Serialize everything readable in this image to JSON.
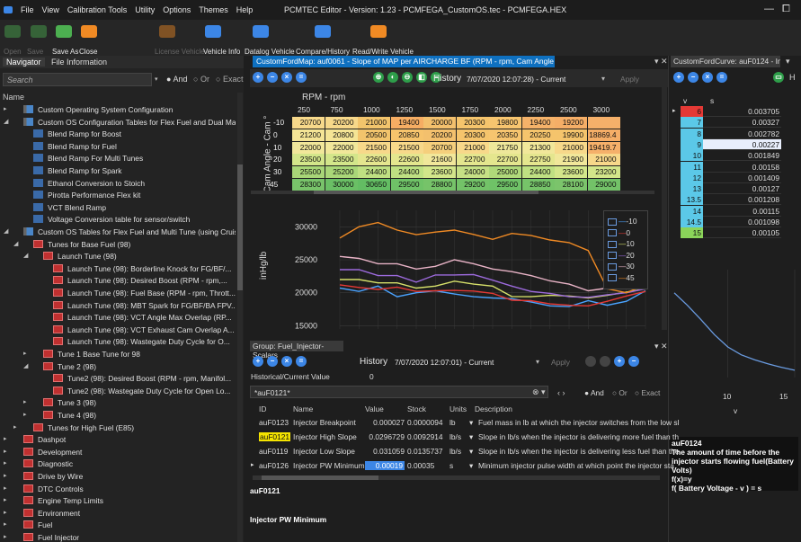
{
  "app": {
    "menu": [
      "File",
      "View",
      "Calibration Tools",
      "Utility",
      "Options",
      "Themes",
      "Help"
    ],
    "title": "PCMTEC Editor - Version: 1.23 - PCMFEGA_CustomOS.tec - PCMFEGA.HEX",
    "window_controls": [
      "—",
      "⧠"
    ]
  },
  "ribbon": {
    "labels": [
      "Open",
      "Save",
      "Save As",
      "Close",
      "License Vehicle",
      "Vehicle Info",
      "Datalog Vehicle",
      "Compare/History",
      "Read/Write Vehicle"
    ],
    "active_labels": [
      "Save As",
      "Close",
      "Vehicle Info",
      "Datalog Vehicle",
      "Compare/History",
      "Read/Write Vehicle"
    ],
    "colors": {
      "green": "#4caf50",
      "orange": "#f08a24",
      "blue": "#3c86e6"
    }
  },
  "navigator": {
    "tabs": [
      "Navigator",
      "File Information"
    ],
    "search_placeholder": "Search",
    "radio_and": "And",
    "radio_or": "Or",
    "radio_exact": "Exact",
    "column": "Name",
    "items": [
      {
        "indent": 0,
        "arrow": "▸",
        "icon": "cfg",
        "label": "Custom Operating System Configuration"
      },
      {
        "indent": 0,
        "arrow": "◢",
        "icon": "cfg",
        "label": "Custom OS Configuration Tables for Flex Fuel and Dual Ma..."
      },
      {
        "indent": 1,
        "arrow": "",
        "icon": "blue",
        "label": "Blend Ramp for Boost"
      },
      {
        "indent": 1,
        "arrow": "",
        "icon": "blue",
        "label": "Blend Ramp for Fuel"
      },
      {
        "indent": 1,
        "arrow": "",
        "icon": "blue",
        "label": "Blend Ramp For Multi Tunes"
      },
      {
        "indent": 1,
        "arrow": "",
        "icon": "blue",
        "label": "Blend Ramp for Spark"
      },
      {
        "indent": 1,
        "arrow": "",
        "icon": "blue",
        "label": "Ethanol Conversion to Stoich"
      },
      {
        "indent": 1,
        "arrow": "",
        "icon": "blue",
        "label": "Pirotta Performance Flex kit"
      },
      {
        "indent": 1,
        "arrow": "",
        "icon": "blue",
        "label": "VCT Blend Ramp"
      },
      {
        "indent": 1,
        "arrow": "",
        "icon": "blue",
        "label": "Voltage Conversion table for sensor/switch"
      },
      {
        "indent": 0,
        "arrow": "◢",
        "icon": "cfg",
        "label": "Custom OS Tables for Flex Fuel and Multi Tune (using Cruis..."
      },
      {
        "indent": 1,
        "arrow": "◢",
        "icon": "sheet",
        "label": "Tunes for Base Fuel (98)"
      },
      {
        "indent": 2,
        "arrow": "◢",
        "icon": "sheet",
        "label": "Launch Tune (98)"
      },
      {
        "indent": 3,
        "arrow": "",
        "icon": "sheet",
        "label": "Launch Tune (98): Borderline Knock for FG/BF/..."
      },
      {
        "indent": 3,
        "arrow": "",
        "icon": "sheet",
        "label": "Launch Tune (98): Desired Boost (RPM - rpm,..."
      },
      {
        "indent": 3,
        "arrow": "",
        "icon": "sheet",
        "label": "Launch Tune (98): Fuel Base (RPM - rpm, Thrott..."
      },
      {
        "indent": 3,
        "arrow": "",
        "icon": "sheet",
        "label": "Launch Tune (98): MBT Spark for FG/BF/BA FPV..."
      },
      {
        "indent": 3,
        "arrow": "",
        "icon": "sheet",
        "label": "Launch Tune (98): VCT Angle Max Overlap (RP..."
      },
      {
        "indent": 3,
        "arrow": "",
        "icon": "sheet",
        "label": "Launch Tune (98): VCT Exhaust Cam Overlap A..."
      },
      {
        "indent": 3,
        "arrow": "",
        "icon": "sheet",
        "label": "Launch Tune (98): Wastegate Duty Cycle for O..."
      },
      {
        "indent": 2,
        "arrow": "▸",
        "icon": "sheet",
        "label": "Tune 1 Base Tune for 98"
      },
      {
        "indent": 2,
        "arrow": "◢",
        "icon": "sheet",
        "label": "Tune 2 (98)"
      },
      {
        "indent": 3,
        "arrow": "",
        "icon": "sheet",
        "label": "Tune2 (98): Desired Boost (RPM - rpm, Manifol..."
      },
      {
        "indent": 3,
        "arrow": "",
        "icon": "sheet",
        "label": "Tune2 (98): Wastegate Duty Cycle for Open Lo..."
      },
      {
        "indent": 2,
        "arrow": "▸",
        "icon": "sheet",
        "label": "Tune 3 (98)"
      },
      {
        "indent": 2,
        "arrow": "▸",
        "icon": "sheet",
        "label": "Tune 4 (98)"
      },
      {
        "indent": 1,
        "arrow": "▸",
        "icon": "sheet",
        "label": "Tunes for High Fuel (E85)"
      },
      {
        "indent": 0,
        "arrow": "▸",
        "icon": "sheet",
        "label": "Dashpot"
      },
      {
        "indent": 0,
        "arrow": "▸",
        "icon": "sheet",
        "label": "Development"
      },
      {
        "indent": 0,
        "arrow": "▸",
        "icon": "sheet",
        "label": "Diagnostic"
      },
      {
        "indent": 0,
        "arrow": "▸",
        "icon": "sheet",
        "label": "Drive by Wire"
      },
      {
        "indent": 0,
        "arrow": "▸",
        "icon": "sheet",
        "label": "DTC Controls"
      },
      {
        "indent": 0,
        "arrow": "▸",
        "icon": "sheet",
        "label": "Engine Temp Limits"
      },
      {
        "indent": 0,
        "arrow": "▸",
        "icon": "sheet",
        "label": "Environment"
      },
      {
        "indent": 0,
        "arrow": "▸",
        "icon": "sheet",
        "label": "Fuel"
      },
      {
        "indent": 0,
        "arrow": "▸",
        "icon": "sheet",
        "label": "Fuel Injector"
      }
    ]
  },
  "map": {
    "tab": "CustomFordMap: auf0061 - Slope of MAP per AIRCHARGE BF (RPM - rpm, Cam Angle - Cam °)",
    "history_label": "History",
    "history_value": "7/07/2020 12:07:28) - Current",
    "apply": "Apply",
    "x_axis_title": "RPM - rpm",
    "y_axis_title": "Cam Angle - Cam °",
    "columns": [
      "250",
      "750",
      "1000",
      "1250",
      "1500",
      "1750",
      "2000",
      "2250",
      "2500",
      "3000"
    ],
    "rows": [
      {
        "label": "-10",
        "values": [
          "20700",
          "20200",
          "21000",
          "19400",
          "20000",
          "20300",
          "19800",
          "19400",
          "19200",
          ""
        ],
        "colors": [
          "#f7d88a",
          "#f7d88a",
          "#f2c46c",
          "#f6ad63",
          "#f3c06d",
          "#f5c46c",
          "#f7c56f",
          "#f5b269",
          "#f5ae67",
          "#f5b06a"
        ]
      },
      {
        "label": "0",
        "values": [
          "21200",
          "20800",
          "20500",
          "20850",
          "20200",
          "20300",
          "20350",
          "20250",
          "19900",
          "18869.4"
        ],
        "colors": [
          "#f4e495",
          "#f4e495",
          "#f2c46c",
          "#f6c36c",
          "#f3c06d",
          "#f5c46c",
          "#f7c56f",
          "#f5c46c",
          "#f5c46c",
          "#f5ae67"
        ]
      },
      {
        "label": "10",
        "values": [
          "22000",
          "22000",
          "21500",
          "21500",
          "20700",
          "21000",
          "21750",
          "21300",
          "21000",
          "19419.7"
        ],
        "colors": [
          "#f1e79a",
          "#f1e79a",
          "#f7d88a",
          "#f7d88a",
          "#f5cf7c",
          "#f7d88a",
          "#eee79a",
          "#f1e79a",
          "#f7d88a",
          "#f5b06a"
        ]
      },
      {
        "label": "20",
        "values": [
          "23500",
          "23500",
          "22600",
          "22600",
          "21600",
          "22700",
          "22700",
          "22750",
          "21900",
          "21000"
        ],
        "colors": [
          "#d3e68a",
          "#d3e68a",
          "#e4e68e",
          "#e4e68e",
          "#f1e79a",
          "#e4e68e",
          "#e4e68e",
          "#e4e68e",
          "#f1e79a",
          "#f7d88a"
        ]
      },
      {
        "label": "30",
        "values": [
          "25500",
          "25200",
          "24400",
          "24400",
          "23600",
          "24000",
          "25000",
          "24400",
          "23600",
          "23200"
        ],
        "colors": [
          "#a8d677",
          "#aad778",
          "#bfe082",
          "#bfe082",
          "#d3e68a",
          "#c6e085",
          "#b0d97a",
          "#bfe082",
          "#d3e68a",
          "#d3e68a"
        ]
      },
      {
        "label": "45",
        "values": [
          "28300",
          "30000",
          "30650",
          "29500",
          "28800",
          "29200",
          "29500",
          "28850",
          "28100",
          "29000"
        ],
        "colors": [
          "#78c36a",
          "#6abf65",
          "#63bd63",
          "#6fc267",
          "#76c369",
          "#73c268",
          "#6fc267",
          "#76c369",
          "#7bc46b",
          "#73c268"
        ]
      }
    ]
  },
  "chart_data": {
    "type": "line",
    "ylabel": "inHg/lb",
    "yticks": [
      "15000",
      "20000",
      "25000",
      "30000"
    ],
    "ylim": [
      14500,
      32500
    ],
    "x": [
      "250",
      "750",
      "1000",
      "1250",
      "1500",
      "1750",
      "2000",
      "2250",
      "2500",
      "3000",
      "3500",
      "4000",
      "4500",
      "5000",
      "5500",
      "6000",
      "6500"
    ],
    "series": [
      {
        "name": "-10",
        "color": "#4aa3ff",
        "values": [
          20700,
          20200,
          21000,
          19400,
          20000,
          20300,
          19800,
          19400,
          19200,
          19100,
          18600,
          18000,
          17900,
          18800,
          18100,
          18700,
          20300
        ]
      },
      {
        "name": "0",
        "color": "#e53935",
        "values": [
          21200,
          20800,
          20500,
          20850,
          20200,
          20300,
          20350,
          20250,
          19900,
          18870,
          18800,
          18300,
          18100,
          18000,
          18700,
          19500,
          20200
        ]
      },
      {
        "name": "10",
        "color": "#d6e06a",
        "values": [
          22000,
          22000,
          21500,
          21500,
          20700,
          21000,
          21750,
          21300,
          21000,
          19420,
          19400,
          19600,
          19500,
          19200,
          19600,
          20100,
          20600
        ]
      },
      {
        "name": "20",
        "color": "#9c6adc",
        "values": [
          23500,
          23500,
          22600,
          22600,
          21600,
          22700,
          22700,
          22750,
          21900,
          21000,
          20200,
          19900,
          19400,
          19300,
          19700,
          20000,
          20600
        ]
      },
      {
        "name": "30",
        "color": "#e8b3c6",
        "values": [
          25500,
          25200,
          24400,
          24400,
          23600,
          24000,
          25000,
          24400,
          23600,
          23200,
          22600,
          21800,
          21300,
          20300,
          20700,
          21200,
          22000
        ]
      },
      {
        "name": "45",
        "color": "#f08a24",
        "values": [
          28300,
          30000,
          30650,
          29500,
          28800,
          29200,
          29500,
          28850,
          28100,
          29000,
          28700,
          28000,
          27600,
          26400,
          20600,
          20000,
          21200
        ]
      }
    ]
  },
  "scalars": {
    "tab": "Group: Fuel_Injector-Scalars",
    "history_label": "History",
    "history_value": "7/07/2020 12:07:01) - Current",
    "apply": "Apply",
    "hist_current_label": "Historical/Current Value",
    "hist_current_value": "0",
    "filter": "*auF0121*",
    "radio_and": "And",
    "radio_or": "Or",
    "radio_exact": "Exact",
    "headers": [
      "ID",
      "Name",
      "Value",
      "Stock",
      "Units",
      "Description"
    ],
    "rows": [
      {
        "id": "auF0123",
        "name": "Injector Breakpoint",
        "value": "0.000027",
        "stock": "0.0000094",
        "units": "lb",
        "desc": "Fuel mass in lb at which the injector switches from the low sl"
      },
      {
        "id": "auF0121",
        "name": "Injector High Slope",
        "value": "0.0296729",
        "stock": "0.0092914",
        "units": "lb/s",
        "desc": "Slope in lb/s when the injector is delivering more fuel than th"
      },
      {
        "id": "auF0119",
        "name": "Injector Low Slope",
        "value": "0.031059",
        "stock": "0.0135737",
        "units": "lb/s",
        "desc": "Slope in lb/s when the injector is delivering less fuel than the"
      },
      {
        "id": "auF0126",
        "name": "Injector PW Minimum",
        "value": "0.00019",
        "stock": "0.00035",
        "units": "s",
        "desc": "Minimum injector pulse width at which point the injector sta"
      }
    ],
    "selected_id": "auF0121",
    "selected_name": "Injector PW Minimum"
  },
  "curve": {
    "tab": "CustomFordCurve: auF0124 - In...",
    "col_v": "v",
    "col_s": "s",
    "rows": [
      {
        "v": "6",
        "s": "0.003705",
        "color": "#e53935"
      },
      {
        "v": "7",
        "s": "0.00327",
        "color": "#5bc8e8"
      },
      {
        "v": "8",
        "s": "0.002782",
        "color": "#5bc8e8"
      },
      {
        "v": "9",
        "s": "0.00227",
        "color": "#5bc8e8"
      },
      {
        "v": "10",
        "s": "0.001849",
        "color": "#5bc8e8"
      },
      {
        "v": "11",
        "s": "0.00158",
        "color": "#5bc8e8"
      },
      {
        "v": "12",
        "s": "0.001409",
        "color": "#5bc8e8"
      },
      {
        "v": "13",
        "s": "0.00127",
        "color": "#5bc8e8"
      },
      {
        "v": "13.5",
        "s": "0.001208",
        "color": "#5bc8e8"
      },
      {
        "v": "14",
        "s": "0.00115",
        "color": "#5bc8e8"
      },
      {
        "v": "14.5",
        "s": "0.001098",
        "color": "#5bc8e8"
      },
      {
        "v": "15",
        "s": "0.00105",
        "color": "#8bd45a"
      }
    ],
    "chart_xticks": [
      "10",
      "15"
    ],
    "chart_xlabel": "v",
    "desc_id": "auF0124",
    "desc_text": "The amount of time before the injector starts flowing fuel(Battery Volts)",
    "desc_f": "f(x)=y",
    "desc_formula": "f( Battery Voltage - v ) = s"
  }
}
